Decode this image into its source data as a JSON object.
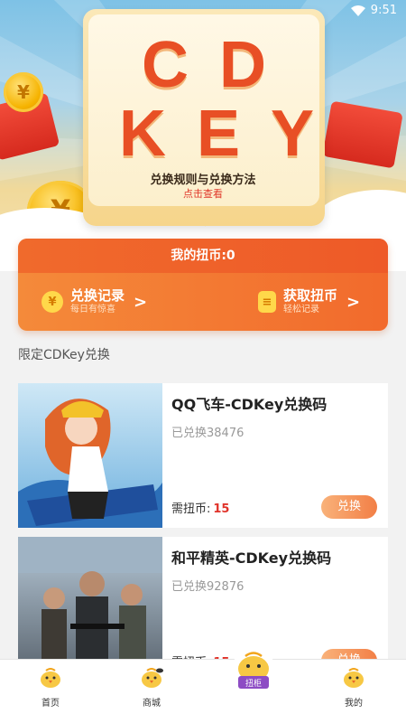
{
  "status_bar": {
    "time": "9:51"
  },
  "banner": {
    "title_line1": "CD",
    "title_line2": "KEY",
    "rules_title": "兑换规则与兑换方法",
    "rules_link": "点击查看"
  },
  "wallet": {
    "balance_label": "我的扭币:0",
    "redeem_records": {
      "title": "兑换记录",
      "subtitle": "每日有惊喜"
    },
    "earn_coins": {
      "title": "获取扭币",
      "subtitle": "轻松记录"
    }
  },
  "section_title": "限定CDKey兑换",
  "products": [
    {
      "name": "QQ飞车-CDKey兑换码",
      "redeemed": "已兑换38476",
      "price_label": "需扭币:",
      "price": "15",
      "button": "兑换"
    },
    {
      "name": "和平精英-CDKey兑换码",
      "redeemed": "已兑换92876",
      "price_label": "需扭币:",
      "price": "15",
      "button": "兑换"
    }
  ],
  "bottom_nav": {
    "items": [
      {
        "label": "首页"
      },
      {
        "label": "商城"
      },
      {
        "label": "扭柜"
      },
      {
        "label": "我的"
      }
    ]
  },
  "colors": {
    "accent": "#f26a2c",
    "price": "#e0332a",
    "brand_text": "#e84f25"
  }
}
